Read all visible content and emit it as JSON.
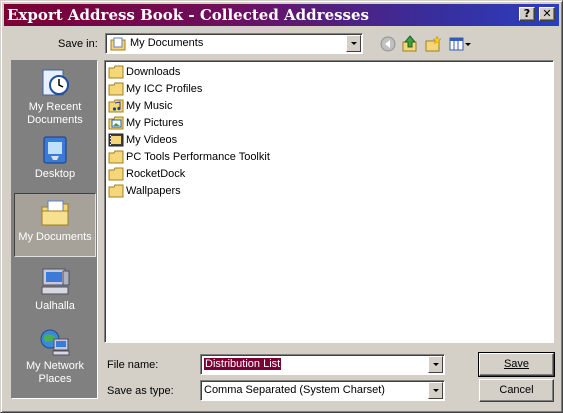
{
  "window": {
    "title": "Export Address Book - Collected Addresses"
  },
  "title_buttons": {
    "help": "?",
    "close": "✕"
  },
  "save_in": {
    "label": "Save in:",
    "value": "My Documents"
  },
  "toolbar": {
    "icons": [
      "back-icon",
      "up-folder-icon",
      "new-folder-icon",
      "view-menu-icon"
    ]
  },
  "places": [
    {
      "label": "My Recent Documents",
      "icon": "recent-documents-icon"
    },
    {
      "label": "Desktop",
      "icon": "desktop-icon"
    },
    {
      "label": "My Documents",
      "icon": "my-documents-icon",
      "selected": true
    },
    {
      "label": "Ualhalla",
      "icon": "my-computer-icon"
    },
    {
      "label": "My Network Places",
      "icon": "network-places-icon"
    }
  ],
  "files": [
    {
      "name": "Downloads",
      "icon": "folder-icon"
    },
    {
      "name": "My ICC Profiles",
      "icon": "folder-icon"
    },
    {
      "name": "My Music",
      "icon": "music-folder-icon"
    },
    {
      "name": "My Pictures",
      "icon": "pictures-folder-icon"
    },
    {
      "name": "My Videos",
      "icon": "videos-folder-icon"
    },
    {
      "name": "PC Tools Performance Toolkit",
      "icon": "folder-icon"
    },
    {
      "name": "RocketDock",
      "icon": "folder-icon"
    },
    {
      "name": "Wallpapers",
      "icon": "folder-icon"
    }
  ],
  "file_name": {
    "label": "File name:",
    "value": "Distribution List"
  },
  "save_as_type": {
    "label": "Save as type:",
    "value": "Comma Separated (System Charset)"
  },
  "buttons": {
    "save": "Save",
    "cancel": "Cancel"
  },
  "colors": {
    "title_start": "#7b0034",
    "title_end": "#2a3ec0",
    "selection": "#7b0034",
    "face": "#d4d0c8"
  }
}
